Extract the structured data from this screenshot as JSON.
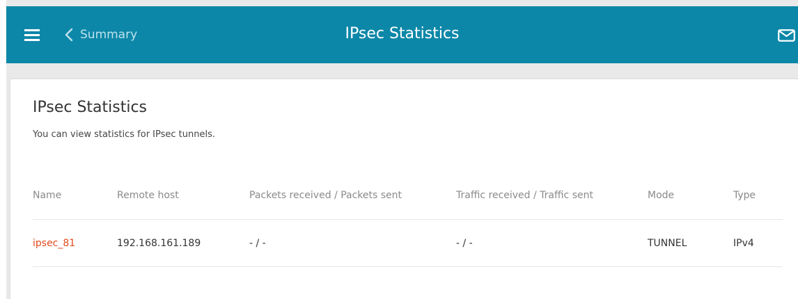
{
  "header": {
    "back_label": "Summary",
    "title": "IPsec Statistics",
    "icons": {
      "menu": "hamburger-menu-icon",
      "back": "chevron-left-icon",
      "mail": "mail-envelope-icon"
    }
  },
  "card": {
    "title": "IPsec Statistics",
    "description": "You can view statistics for IPsec tunnels."
  },
  "table": {
    "columns": [
      "Name",
      "Remote host",
      "Packets received / Packets sent",
      "Traffic received / Traffic sent",
      "Mode",
      "Type"
    ],
    "rows": [
      [
        "ipsec_81",
        "192.168.161.189",
        "- / -",
        "- / -",
        "TUNNEL",
        "IPv4"
      ]
    ]
  },
  "colors": {
    "topbar": "#0d87a8",
    "link": "#e24a1d",
    "background": "#e9e9e9"
  }
}
